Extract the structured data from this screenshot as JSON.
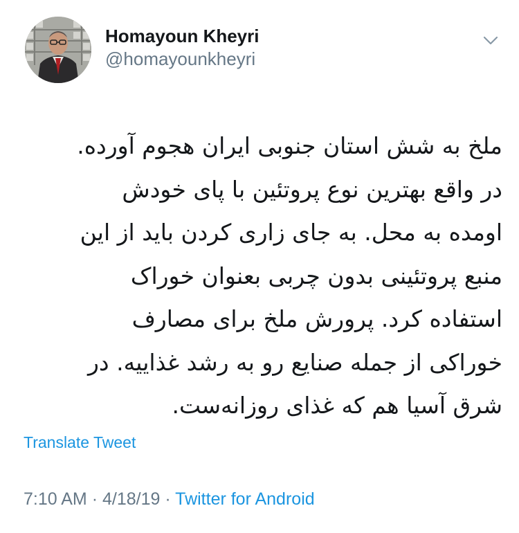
{
  "author": {
    "display_name": "Homayoun Kheyri",
    "handle": "@homayounkheyri",
    "avatar_icon": "profile-photo"
  },
  "menu_icon": "chevron-down-icon",
  "tweet": {
    "lines": [
      "ملخ به شش استان جنوبی ایران هجوم آورده.",
      "در واقع بهترین نوع پروتئین با پای خودش",
      "اومده به محل. به جای زاری کردن باید از این",
      "منبع پروتئینی بدون چربی بعنوان خوراک",
      "استفاده کرد. پرورش ملخ برای مصارف",
      "خوراکی از جمله صنایع رو به رشد غذاییه. در",
      "شرق آسیا هم که غذای روزانه‌ست."
    ]
  },
  "translate_label": "Translate Tweet",
  "meta": {
    "time": "7:10 AM",
    "date": "4/18/19",
    "separator": "·",
    "source": "Twitter for Android"
  },
  "colors": {
    "link": "#1b95e0",
    "secondary": "#657786",
    "primary": "#14171a"
  }
}
